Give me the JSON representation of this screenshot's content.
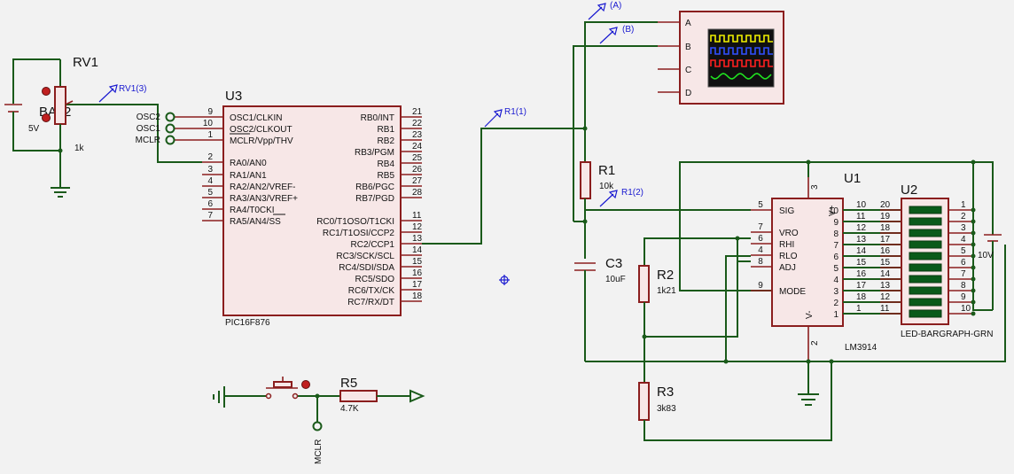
{
  "battery": {
    "ref": "BAT2",
    "value": "5V"
  },
  "rv1": {
    "ref": "RV1",
    "value": "1k",
    "probe": "RV1(3)"
  },
  "u3": {
    "ref": "U3",
    "part": "PIC16F876",
    "left_pins": [
      {
        "num": "9",
        "name": "OSC1/CLKIN"
      },
      {
        "num": "10",
        "name": "OSC2/CLKOUT"
      },
      {
        "num": "1",
        "name": "MCLR/Vpp/THV"
      },
      {
        "num": "2",
        "name": "RA0/AN0"
      },
      {
        "num": "3",
        "name": "RA1/AN1"
      },
      {
        "num": "4",
        "name": "RA2/AN2/VREF-"
      },
      {
        "num": "5",
        "name": "RA3/AN3/VREF+"
      },
      {
        "num": "6",
        "name": "RA4/T0CKI"
      },
      {
        "num": "7",
        "name": "RA5/AN4/SS"
      }
    ],
    "right_pins": [
      {
        "num": "21",
        "name": "RB0/INT"
      },
      {
        "num": "22",
        "name": "RB1"
      },
      {
        "num": "23",
        "name": "RB2"
      },
      {
        "num": "24",
        "name": "RB3/PGM"
      },
      {
        "num": "25",
        "name": "RB4"
      },
      {
        "num": "26",
        "name": "RB5"
      },
      {
        "num": "27",
        "name": "RB6/PGC"
      },
      {
        "num": "28",
        "name": "RB7/PGD"
      },
      {
        "num": "11",
        "name": "RC0/T1OSO/T1CKI"
      },
      {
        "num": "12",
        "name": "RC1/T1OSI/CCP2"
      },
      {
        "num": "13",
        "name": "RC2/CCP1"
      },
      {
        "num": "14",
        "name": "RC3/SCK/SCL"
      },
      {
        "num": "15",
        "name": "RC4/SDI/SDA"
      },
      {
        "num": "16",
        "name": "RC5/SDO"
      },
      {
        "num": "17",
        "name": "RC6/TX/CK"
      },
      {
        "num": "18",
        "name": "RC7/RX/DT"
      }
    ],
    "terminals": [
      "OSC2",
      "OSC1",
      "MCLR"
    ]
  },
  "probes": {
    "r1_1": "R1(1)",
    "r1_2": "R1(2)",
    "a": "(A)",
    "b": "(B)"
  },
  "scope": {
    "channels": [
      "A",
      "B",
      "C",
      "D"
    ],
    "trace_colors": [
      "#f0f000",
      "#3050ff",
      "#ff2020",
      "#20e020"
    ]
  },
  "r1": {
    "ref": "R1",
    "value": "10k"
  },
  "c3": {
    "ref": "C3",
    "value": "10uF"
  },
  "r2": {
    "ref": "R2",
    "value": "1k21"
  },
  "r3": {
    "ref": "R3",
    "value": "3k83"
  },
  "u1": {
    "ref": "U1",
    "part": "LM3914",
    "left_pins": [
      {
        "num": "5",
        "name": "SIG"
      },
      {
        "num": "7",
        "name": "VRO"
      },
      {
        "num": "6",
        "name": "RHI"
      },
      {
        "num": "4",
        "name": "RLO"
      },
      {
        "num": "8",
        "name": "ADJ"
      },
      {
        "num": "9",
        "name": "MODE"
      }
    ],
    "top_pin": {
      "num": "3",
      "name": "V+"
    },
    "bottom_pin": {
      "num": "2",
      "name": "V-"
    },
    "right_pins": [
      "10",
      "9",
      "8",
      "7",
      "6",
      "5",
      "4",
      "3",
      "2",
      "1"
    ],
    "wire_numbers": [
      "10",
      "11",
      "12",
      "13",
      "14",
      "15",
      "16",
      "17",
      "18",
      "1"
    ]
  },
  "u2": {
    "ref": "U2",
    "part": "LED-BARGRAPH-GRN",
    "left_pins": [
      "20",
      "19",
      "18",
      "17",
      "16",
      "15",
      "14",
      "13",
      "12",
      "11"
    ],
    "right_pins": [
      "1",
      "2",
      "3",
      "4",
      "5",
      "6",
      "7",
      "8",
      "9",
      "10"
    ]
  },
  "supply": {
    "value": "10V"
  },
  "button": {
    "ref": "R5",
    "value": "4.7K",
    "terminal": "MCLR"
  }
}
